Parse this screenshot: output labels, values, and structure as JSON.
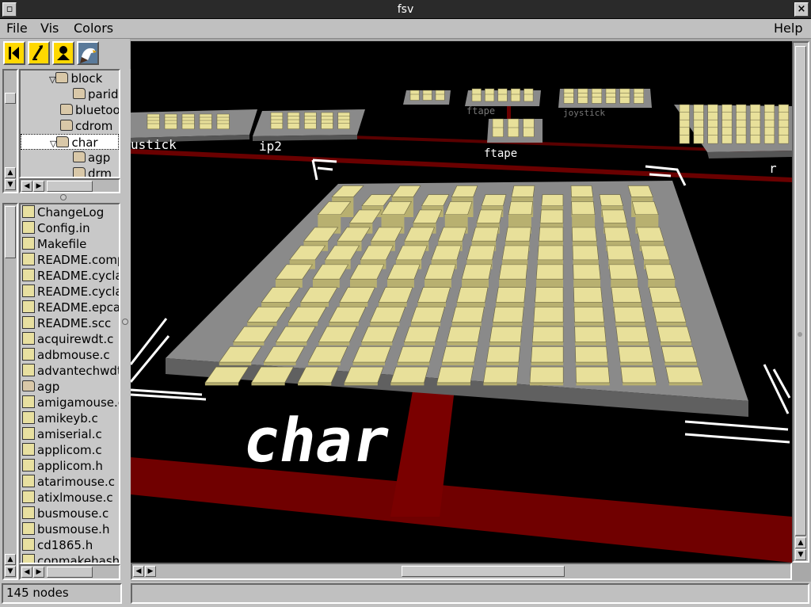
{
  "window": {
    "title": "fsv"
  },
  "menu": {
    "file": "File",
    "vis": "Vis",
    "colors": "Colors",
    "help": "Help"
  },
  "toolbar": {
    "buttons": [
      {
        "name": "back-to-root-icon"
      },
      {
        "name": "cd-up-icon"
      },
      {
        "name": "bird-eye-icon"
      },
      {
        "name": "eagle-logo-icon"
      }
    ]
  },
  "tree": {
    "items": [
      {
        "label": "block",
        "type": "folder",
        "expanded": true
      },
      {
        "label": "paride",
        "type": "folder"
      },
      {
        "label": "bluetooth",
        "type": "folder"
      },
      {
        "label": "cdrom",
        "type": "folder"
      },
      {
        "label": "char",
        "type": "folder",
        "expanded": true,
        "selected": true
      },
      {
        "label": "agp",
        "type": "folder"
      },
      {
        "label": "drm",
        "type": "folder"
      }
    ]
  },
  "files": {
    "items": [
      "ChangeLog",
      "Config.in",
      "Makefile",
      "README.computone",
      "README.cycladesZ",
      "README.cycladesZ",
      "README.epca",
      "README.scc",
      "acquirewdt.c",
      "adbmouse.c",
      "advantechwdt.c",
      "agp",
      "amigamouse.c",
      "amikeyb.c",
      "amiserial.c",
      "applicom.c",
      "applicom.h",
      "atarimouse.c",
      "atixlmouse.c",
      "busmouse.c",
      "busmouse.h",
      "cd1865.h",
      "conmakehash.c"
    ],
    "folder_items": [
      "agp"
    ]
  },
  "status": {
    "nodes": "145 nodes"
  },
  "scene": {
    "main_label": "char",
    "background_labels": [
      "ustick",
      "ip2",
      "ftape",
      "ftape",
      "joystick",
      "r"
    ],
    "colors": {
      "node": "#e8e09a",
      "platform": "#8a8a8a",
      "path": "#7a0000",
      "text": "#ffffff",
      "background": "#000000"
    }
  }
}
